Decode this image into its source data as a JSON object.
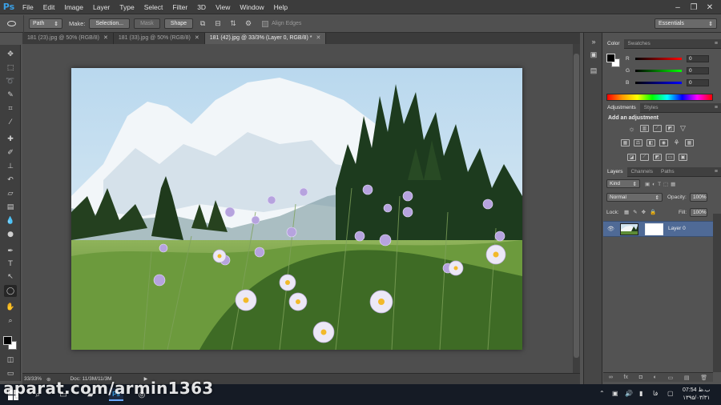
{
  "app": {
    "logo": "Ps"
  },
  "menu": [
    "File",
    "Edit",
    "Image",
    "Layer",
    "Type",
    "Select",
    "Filter",
    "3D",
    "View",
    "Window",
    "Help"
  ],
  "window_controls": {
    "minimize": "–",
    "restore": "❐",
    "close": "✕"
  },
  "options": {
    "mode_value": "Path",
    "make_label": "Make:",
    "selection_label": "Selection...",
    "mask_label": "Mask",
    "shape_label": "Shape",
    "align_edges_label": "Align Edges",
    "workspace": "Essentials"
  },
  "tabs": [
    {
      "label": "181 (23).jpg @ 50% (RGB/8)",
      "active": false
    },
    {
      "label": "181 (33).jpg @ 50% (RGB/8)",
      "active": false
    },
    {
      "label": "181 (42).jpg @ 33/3% (Layer 0, RGB/8) *",
      "active": true
    }
  ],
  "status": {
    "zoom": "33/33%",
    "doc": "Doc: 11/3M/11/3M",
    "arrow": "▶"
  },
  "color_panel": {
    "tabs": [
      "Color",
      "Swatches"
    ],
    "rows": [
      {
        "label": "R",
        "value": "0",
        "ramp": "#ff0000"
      },
      {
        "label": "G",
        "value": "0",
        "ramp": "#00ff00"
      },
      {
        "label": "B",
        "value": "0",
        "ramp": "#0000ff"
      }
    ]
  },
  "adjustments_panel": {
    "tabs": [
      "Adjustments",
      "Styles"
    ],
    "title": "Add an adjustment"
  },
  "layers_panel": {
    "tabs": [
      "Layers",
      "Channels",
      "Paths"
    ],
    "kind": "Kind",
    "blend_mode": "Normal",
    "opacity_label": "Opacity:",
    "opacity_value": "100%",
    "lock_label": "Lock:",
    "fill_label": "Fill:",
    "fill_value": "100%",
    "layer_name": "Layer 0"
  },
  "taskbar": {
    "watermark": "aparat.com/armin1363",
    "lang": "فا",
    "time": "07:54 ب.ظ",
    "date": "۱۳۹۵/۰۳/۳۱"
  },
  "colors": {
    "accent": "#3aa0e6",
    "selected_layer": "#4f6a96",
    "panel_bg": "#535353"
  }
}
